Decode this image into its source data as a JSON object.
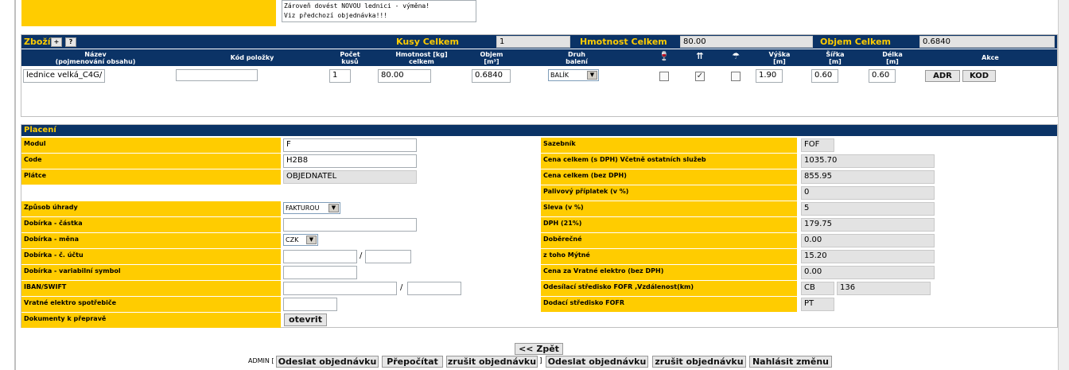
{
  "note": {
    "line1": "Zároveň dovést NOVOU lednici - výměna!",
    "line2": "Viz předchozí objednávka!!!"
  },
  "goods": {
    "title": "Zboží",
    "plus_label": "+",
    "help_label": "?",
    "kusy_label": "Kusy Celkem",
    "kusy_value": "1",
    "hmotnost_label": "Hmotnost Celkem",
    "hmotnost_value": "80.00",
    "objem_label": "Objem Celkem",
    "objem_value": "0.6840",
    "columns": {
      "nazev": "Název",
      "nazev2": "(pojmenování obsahu)",
      "kod": "Kód položky",
      "pocet": "Počet",
      "pocet2": "kusů",
      "hmotnost": "Hmotnost [kg]",
      "hmotnost2": "celkem",
      "objem": "Objem",
      "objem2": "[m³]",
      "druh": "Druh",
      "druh2": "balení",
      "vyska": "Výška",
      "vyska2": "[m]",
      "sirka": "Šířka",
      "sirka2": "[m]",
      "delka": "Délka",
      "delka2": "[m]",
      "akce": "Akce"
    },
    "row": {
      "nazev": "lednice velká_C4G/",
      "kod": "",
      "pocet": "1",
      "hmotnost": "80.00",
      "objem": "0.6840",
      "druh": "BALÍK",
      "chk1": false,
      "chk2": true,
      "chk3": false,
      "vyska": "1.90",
      "sirka": "0.60",
      "delka": "0.60",
      "adr_label": "ADR",
      "kod_label": "KOD"
    }
  },
  "payment": {
    "title": "Placení",
    "modul_label": "Modul",
    "modul_value": "F",
    "code_label": "Code",
    "code_value": "H2B8",
    "platce_label": "Plátce",
    "platce_value": "OBJEDNATEL",
    "zpusob_label": "Způsob úhrady",
    "zpusob_value": "FAKTUROU",
    "dobirka_castka_label": "Dobírka - částka",
    "dobirka_castka_value": "",
    "dobirka_mena_label": "Dobírka - měna",
    "dobirka_mena_value": "CZK",
    "dobirka_ucet_label": "Dobírka - č. účtu",
    "ucet_sep": "/",
    "dobirka_vs_label": "Dobírka - variabilní symbol",
    "iban_label": "IBAN/SWIFT",
    "iban_sep": "/",
    "vratne_label": "Vratné elektro spotřebiče",
    "dokumenty_label": "Dokumenty k přepravě",
    "otevrit_label": "otevrit",
    "sazebnik_label": "Sazebník",
    "sazebnik_value": "FOF",
    "cena_dph_label": "Cena celkem (s DPH) Včetně ostatních služeb",
    "cena_dph_value": "1035.70",
    "cena_bez_label": "Cena celkem (bez DPH)",
    "cena_bez_value": "855.95",
    "palivovy_label": "Palivový příplatek (v %)",
    "palivovy_value": "0",
    "sleva_label": "Sleva (v %)",
    "sleva_value": "5",
    "dph_label": "DPH (21%)",
    "dph_value": "179.75",
    "doberecne_label": "Doběrečné",
    "doberecne_value": "0.00",
    "mytne_label": "z toho Mýtné",
    "mytne_value": "15.20",
    "vratne_cena_label": "Cena za Vratné elektro (bez DPH)",
    "vratne_cena_value": "0.00",
    "odesilaci_label": "Odesílací středisko FOFR ,Vzdálenost(km)",
    "odesilaci_value": "CB",
    "vzdalenost_value": "136",
    "dodaci_label": "Dodací středisko FOFR",
    "dodaci_value": "PT"
  },
  "footer": {
    "zpet_label": "<< Zpět",
    "admin_label": "ADMIN [",
    "odeslat1_label": "Odeslat objednávku",
    "prepocitat_label": "Přepočítat",
    "zrusit1_label": "zrušit objednávku",
    "bracket_close": "]",
    "odeslat2_label": "Odeslat objednávku",
    "zrusit2_label": "zrušit objednávku",
    "nahlasit_label": "Nahlásit změnu"
  },
  "colors": {
    "yellow": "#ffcc00",
    "navy": "#0b3366"
  }
}
